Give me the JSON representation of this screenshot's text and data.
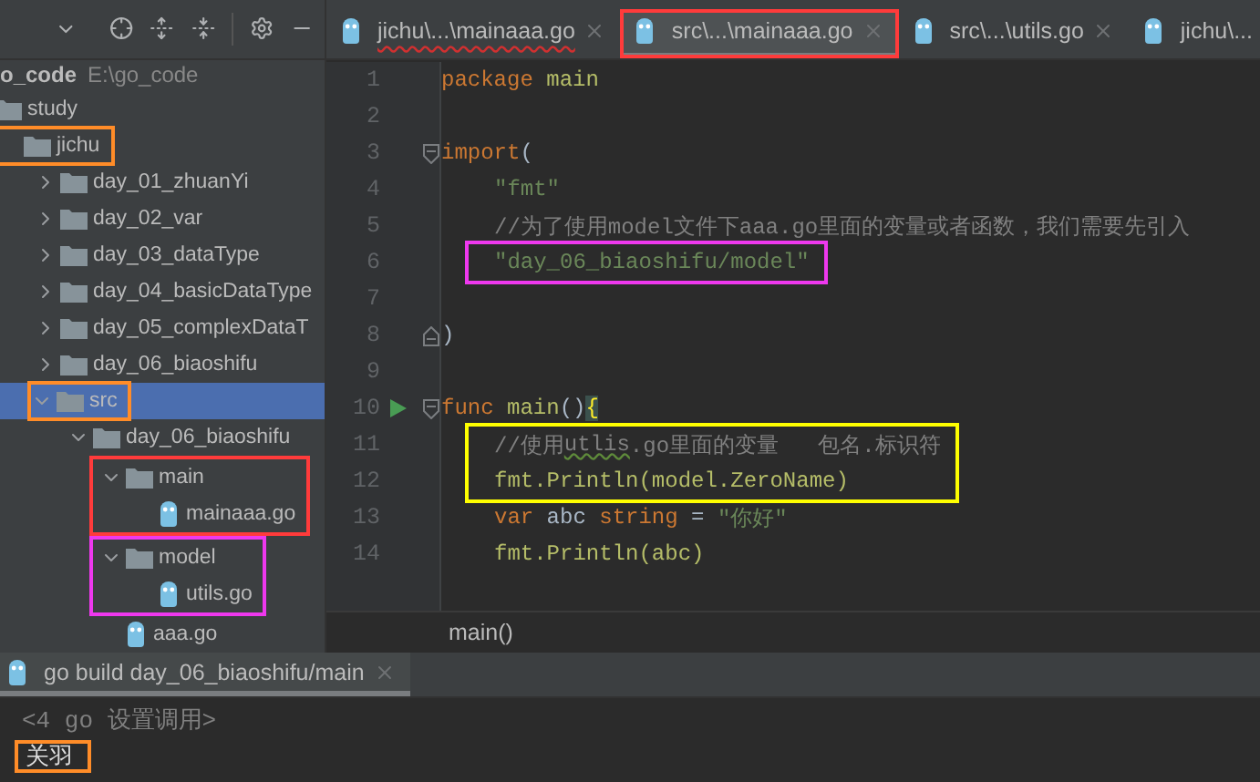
{
  "project": {
    "root": {
      "name": "o_code",
      "path": "E:\\go_code"
    },
    "tree": [
      {
        "label": "study",
        "kind": "folder",
        "selected": false,
        "children": [
          {
            "label": "jichu",
            "kind": "folder",
            "selected": false,
            "color": "#ff8c28",
            "boxed_children": false,
            "children": [
              {
                "label": "day_01_zhuanYi",
                "kind": "folder",
                "expanded": false,
                "selected": false
              },
              {
                "label": "day_02_var",
                "kind": "folder",
                "expanded": false,
                "selected": false
              },
              {
                "label": "day_03_dataType",
                "kind": "folder",
                "expanded": false,
                "selected": false
              },
              {
                "label": "day_04_basicDataType",
                "kind": "folder",
                "expanded": false,
                "selected": false
              },
              {
                "label": "day_05_complexDataT",
                "kind": "folder",
                "expanded": false,
                "selected": false
              },
              {
                "label": "day_06_biaoshifu",
                "kind": "folder",
                "expanded": false,
                "selected": false
              },
              {
                "label": "src",
                "kind": "folder",
                "expanded": true,
                "selected": true,
                "color": "#ff8c28",
                "boxed_children": false,
                "children": [
                  {
                    "label": "day_06_biaoshifu",
                    "kind": "folder",
                    "expanded": true,
                    "selected": false,
                    "children": [
                      {
                        "label": "main",
                        "kind": "folder",
                        "expanded": true,
                        "selected": false,
                        "color": "#ff3b3b",
                        "boxed_children": true,
                        "children": [
                          {
                            "label": "mainaaa.go",
                            "kind": "file",
                            "selected": false
                          }
                        ]
                      },
                      {
                        "label": "model",
                        "kind": "folder",
                        "expanded": true,
                        "selected": false,
                        "color": "#ee38ee",
                        "boxed_children": true,
                        "children": [
                          {
                            "label": "utils.go",
                            "kind": "file",
                            "selected": false
                          }
                        ]
                      },
                      {
                        "label": "aaa.go",
                        "kind": "file",
                        "selected": false
                      }
                    ]
                  }
                ]
              }
            ]
          }
        ]
      }
    ]
  },
  "tabs": [
    {
      "label": "jichu\\...\\mainaaa.go",
      "selected": false,
      "error": true,
      "closable": true
    },
    {
      "label": "src\\...\\mainaaa.go",
      "selected": true,
      "error": false,
      "closable": true,
      "color": "#ff3b3b"
    },
    {
      "label": "src\\...\\utils.go",
      "selected": false,
      "error": false,
      "closable": true
    },
    {
      "label": "jichu\\...",
      "selected": false,
      "error": false,
      "closable": false
    }
  ],
  "editor": {
    "lines": [
      {
        "kind": "line",
        "number": "1",
        "indented": false,
        "tokens": [
          {
            "kind": "keyword",
            "text": "package"
          },
          {
            "kind": "pkg",
            "text": " main"
          }
        ]
      },
      {
        "kind": "line",
        "number": "2"
      },
      {
        "kind": "line",
        "number": "3",
        "indented": false,
        "fold_start": true,
        "tokens": [
          {
            "kind": "keyword",
            "text": "import"
          },
          {
            "kind": "plain",
            "text": "("
          }
        ]
      },
      {
        "kind": "line",
        "number": "4",
        "indented": true,
        "tokens": [
          {
            "kind": "string",
            "text": "\"fmt\""
          }
        ]
      },
      {
        "kind": "line",
        "number": "5",
        "indented": true,
        "tokens": [
          {
            "kind": "comment",
            "text": "//为了使用model文件下aaa.go里面的变量或者函数，我们需要先引入"
          }
        ]
      },
      {
        "kind": "boxed",
        "color": "#ee38ee",
        "lines": [
          {
            "kind": "line",
            "number": "6",
            "indented": true,
            "tokens": [
              {
                "kind": "string",
                "text": "\"day_06_biaoshifu/model\""
              }
            ]
          }
        ]
      },
      {
        "kind": "line",
        "number": "7"
      },
      {
        "kind": "line",
        "number": "8",
        "indented": false,
        "fold_end": true,
        "tokens": [
          {
            "kind": "plain",
            "text": ")"
          }
        ]
      },
      {
        "kind": "line",
        "number": "9"
      },
      {
        "kind": "line",
        "number": "10",
        "indented": false,
        "fold_start": true,
        "runnable": true,
        "tokens": [
          {
            "kind": "keyword",
            "text": "func"
          },
          {
            "kind": "func",
            "text": " main"
          },
          {
            "kind": "plain",
            "text": "()"
          },
          {
            "kind": "brace",
            "text": "{"
          }
        ]
      },
      {
        "kind": "boxed",
        "color": "#ffff00",
        "lines": [
          {
            "kind": "line",
            "number": "11",
            "indented": true,
            "tokens": [
              {
                "kind": "comment",
                "text": "//使用"
              },
              {
                "kind": "typo",
                "text": "utlis"
              },
              {
                "kind": "comment",
                "text": ".go里面的变量   包名.标识符"
              }
            ]
          },
          {
            "kind": "line",
            "number": "12",
            "indented": true,
            "tokens": [
              {
                "kind": "pkg",
                "text": "fmt.Println(model.ZeroName)"
              }
            ]
          }
        ]
      },
      {
        "kind": "line",
        "number": "13",
        "indented": true,
        "tokens": [
          {
            "kind": "keyword",
            "text": "var"
          },
          {
            "kind": "plain",
            "text": " abc "
          },
          {
            "kind": "keyword",
            "text": "string"
          },
          {
            "kind": "plain",
            "text": " = "
          },
          {
            "kind": "string",
            "text": "\"你好\""
          }
        ]
      },
      {
        "kind": "line",
        "number": "14",
        "indented": true,
        "tokens": [
          {
            "kind": "pkg",
            "text": "fmt.Println(abc)"
          }
        ]
      }
    ],
    "breadcrumb": "main()"
  },
  "run": {
    "tab": "go build day_06_biaoshifu/main",
    "output": [
      {
        "kind": "command",
        "text": "<4 go 设置调用>"
      },
      {
        "kind": "result",
        "text": "关羽",
        "color": "#ff8c28"
      }
    ]
  }
}
